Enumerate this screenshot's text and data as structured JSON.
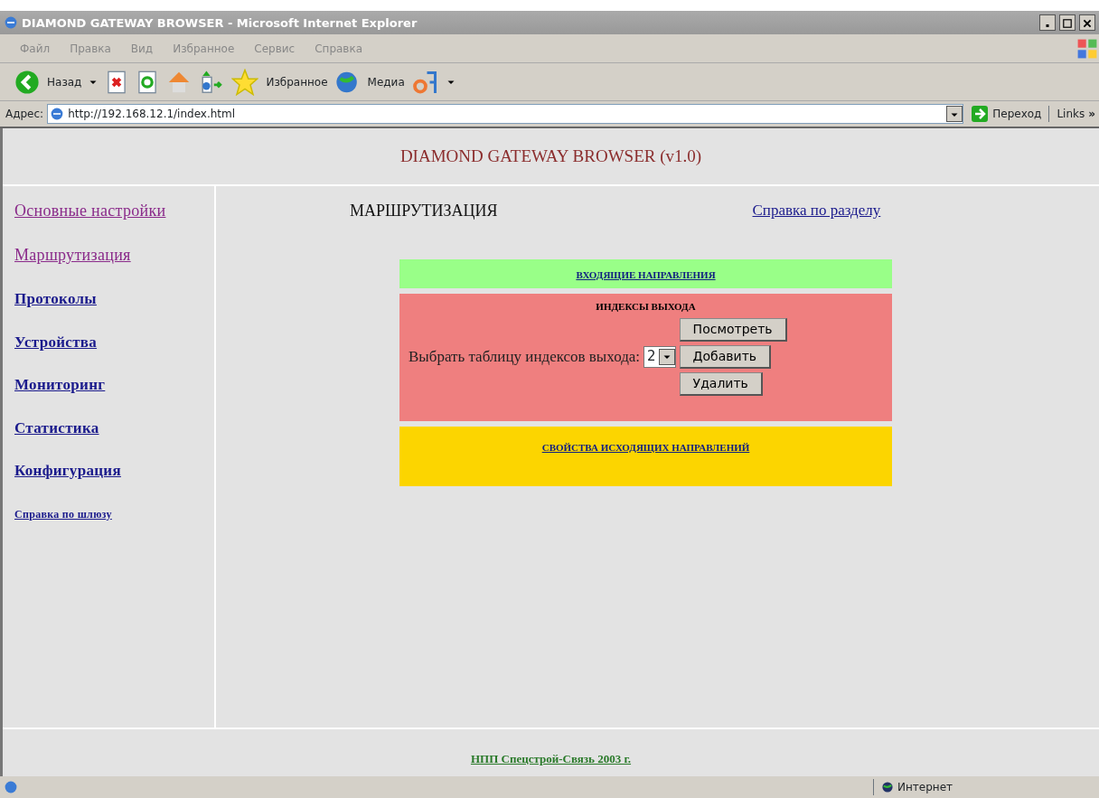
{
  "window": {
    "title": "DIAMOND GATEWAY BROWSER - Microsoft Internet Explorer"
  },
  "menu": [
    "Файл",
    "Правка",
    "Вид",
    "Избранное",
    "Сервис",
    "Справка"
  ],
  "toolbar": {
    "back": "Назад",
    "favorites": "Избранное",
    "media": "Медиа"
  },
  "address_bar": {
    "label": "Адрес:",
    "value": "http://192.168.12.1/index.html",
    "go": "Переход",
    "links": "Links",
    "more": "»"
  },
  "page": {
    "header": "DIAMOND GATEWAY BROWSER (v1.0)",
    "sidebar": [
      {
        "label": "Основные настройки",
        "visited": true,
        "kind": "section"
      },
      {
        "label": "Маршрутизация",
        "visited": true,
        "kind": "section"
      },
      {
        "label": "Протоколы",
        "visited": false,
        "kind": "section"
      },
      {
        "label": "Устройства",
        "visited": false,
        "kind": "section"
      },
      {
        "label": "Мониторинг",
        "visited": false,
        "kind": "section"
      },
      {
        "label": "Статистика",
        "visited": false,
        "kind": "section"
      },
      {
        "label": "Конфигурация",
        "visited": false,
        "kind": "section"
      },
      {
        "label": "Справка по шлюзу",
        "visited": false,
        "kind": "help"
      }
    ],
    "section_title": "МАРШРУТИЗАЦИЯ",
    "help_link": "Справка по разделу",
    "panels": [
      {
        "kind": "link",
        "title": "ВХОДЯЩИЕ НАПРАВЛЕНИЯ",
        "color": "#99ff88"
      },
      {
        "kind": "form",
        "title": "ИНДЕКСЫ ВЫХОДА",
        "color": "#ef7f7f",
        "select_label": "Выбрать таблицу индексов выхода:",
        "select_value": "2",
        "buttons": [
          "Посмотреть",
          "Добавить",
          "Удалить"
        ]
      },
      {
        "kind": "link",
        "title": "СВОЙСТВА ИСХОДЯЩИХ НАПРАВЛЕНИЙ",
        "color": "#fcd500"
      }
    ],
    "footer": "НПП Спецстрой-Связь 2003 г."
  },
  "status_bar": {
    "zone": "Интернет"
  }
}
